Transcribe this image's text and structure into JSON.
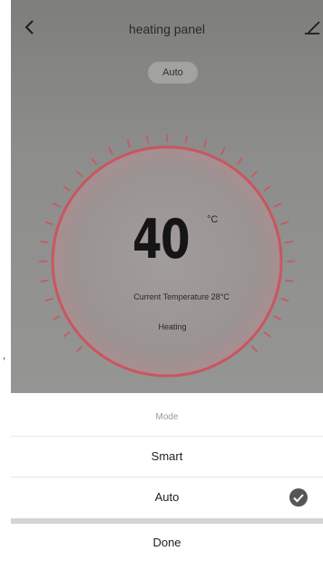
{
  "header": {
    "title": "heating panel",
    "back_icon": "back-arrow-icon",
    "edit_icon": "pencil-icon"
  },
  "mode_badge": "Auto",
  "thermostat": {
    "set_temperature": "40",
    "unit": "°C",
    "current_temperature_text": "Current Temperature 28°C",
    "status": "Heating",
    "ring_color": "#c9565e"
  },
  "side_mark": ",",
  "mode_sheet": {
    "title": "Mode",
    "options": [
      {
        "label": "Smart",
        "selected": false
      },
      {
        "label": "Auto",
        "selected": true
      }
    ],
    "selected_icon": "check-circle-icon",
    "done_label": "Done"
  }
}
